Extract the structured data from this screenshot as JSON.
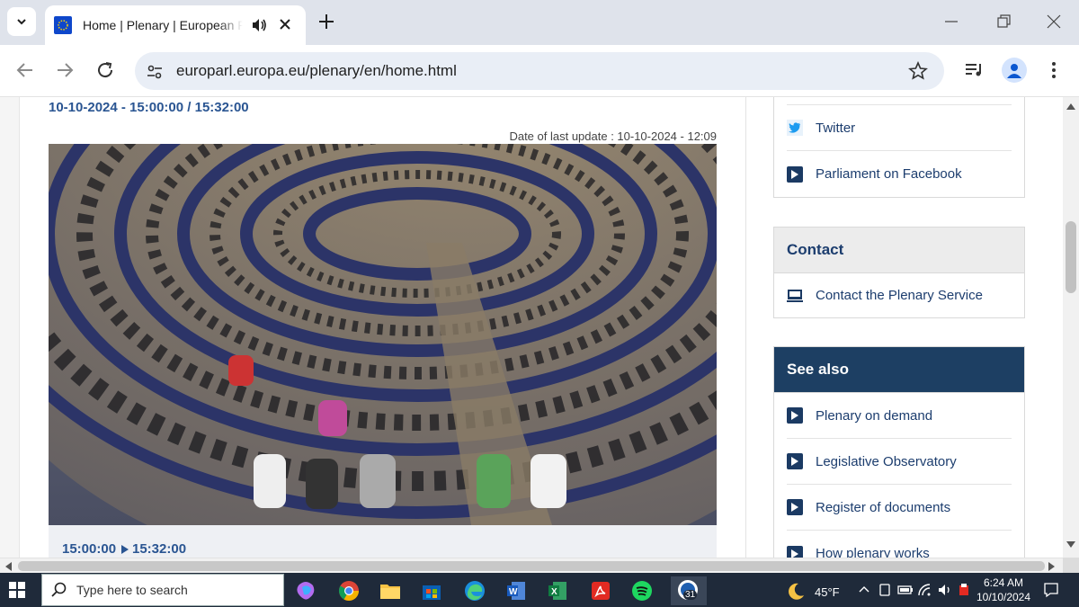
{
  "browser": {
    "tab_title": "Home | Plenary | European Parliament",
    "url": "europarl.europa.eu/plenary/en/home.html",
    "new_tab_label": "+"
  },
  "page": {
    "datetime_heading": "10-10-2024 - 15:00:00 / 15:32:00",
    "last_update": "Date of last update : 10-10-2024 - 12:09",
    "video": {
      "start_time": "15:00:00",
      "end_time": "15:32:00"
    },
    "social": {
      "items": [
        {
          "label": "Twitter",
          "icon": "twitter-icon"
        },
        {
          "label": "Parliament on Facebook",
          "icon": "play-icon"
        }
      ]
    },
    "contact": {
      "title": "Contact",
      "items": [
        {
          "label": "Contact the Plenary Service",
          "icon": "computer-icon"
        }
      ]
    },
    "see_also": {
      "title": "See also",
      "items": [
        {
          "label": "Plenary on demand"
        },
        {
          "label": "Legislative Observatory"
        },
        {
          "label": "Register of documents"
        },
        {
          "label": "How plenary works"
        }
      ]
    }
  },
  "taskbar": {
    "search_placeholder": "Type here to search",
    "weather": "45°F",
    "time": "6:24 AM",
    "date": "10/10/2024",
    "badge": "31"
  },
  "colors": {
    "eu_blue": "#2a5592",
    "dark_header": "#1d3f63",
    "taskbar": "#1f2a3a"
  }
}
